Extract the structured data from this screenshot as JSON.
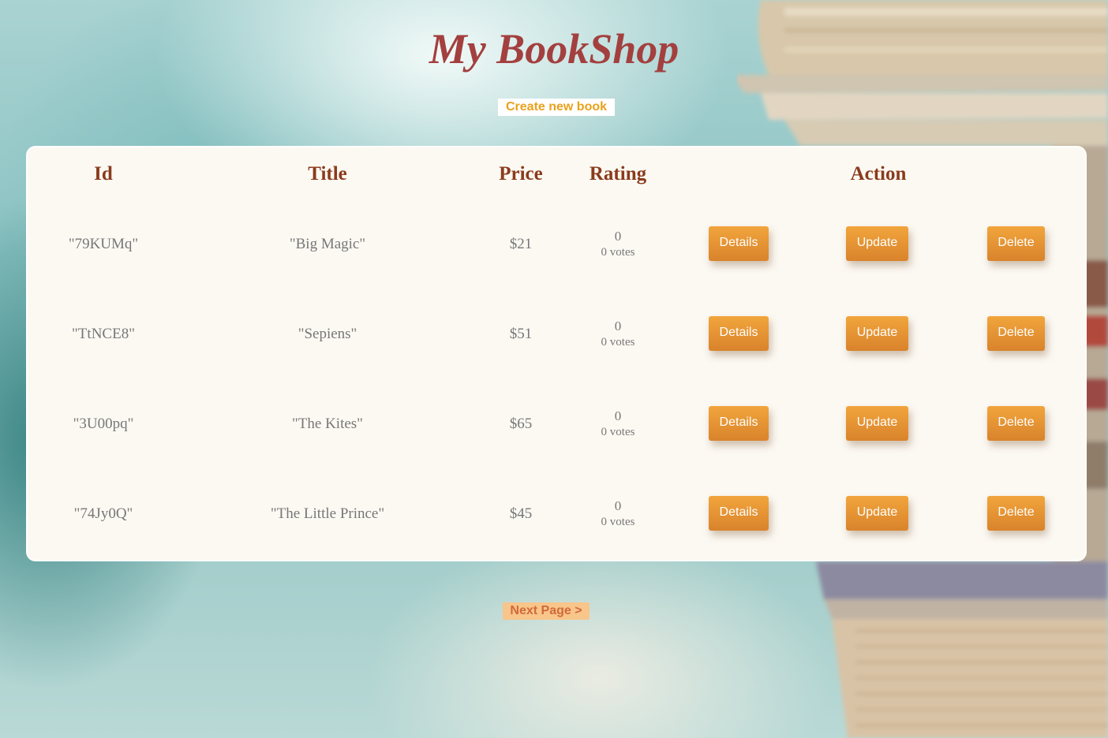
{
  "header": {
    "title": "My BookShop",
    "create_link": "Create new book"
  },
  "table": {
    "columns": [
      "Id",
      "Title",
      "Price",
      "Rating",
      "Action"
    ],
    "rows": [
      {
        "id": "\"79KUMq\"",
        "title": "\"Big Magic\"",
        "price": "$21",
        "rating": "0",
        "votes": "0 votes"
      },
      {
        "id": "\"TtNCE8\"",
        "title": "\"Sepiens\"",
        "price": "$51",
        "rating": "0",
        "votes": "0 votes"
      },
      {
        "id": "\"3U00pq\"",
        "title": "\"The Kites\"",
        "price": "$65",
        "rating": "0",
        "votes": "0 votes"
      },
      {
        "id": "\"74Jy0Q\"",
        "title": "\"The Little Prince\"",
        "price": "$45",
        "rating": "0",
        "votes": "0 votes"
      }
    ],
    "actions": {
      "details": "Details",
      "update": "Update",
      "delete": "Delete"
    }
  },
  "pagination": {
    "next": "Next Page >"
  },
  "colors": {
    "title": "#a3403f",
    "header_text": "#8a3b1c",
    "button_top": "#f1a53c",
    "button_bottom": "#d9832c",
    "link_accent": "#eaa21c",
    "card_bg": "#fcf9f3"
  }
}
